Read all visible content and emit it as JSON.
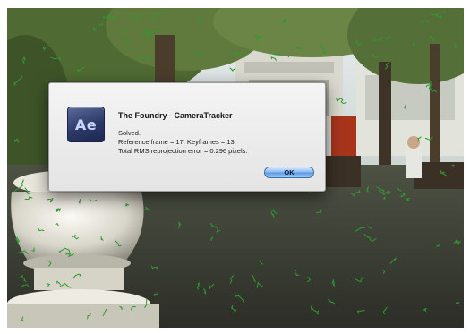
{
  "dialog": {
    "icon_text": "Ae",
    "title": "The Foundry - CameraTracker",
    "lines": [
      "Solved.",
      "Reference frame = 17. Keyframes = 13.",
      "Total RMS reprojection error = 0.296 pixels."
    ],
    "ok_label": "OK"
  },
  "colors": {
    "track_marks": "#2f9a2f",
    "ok_button": "#7fb4ee"
  },
  "icons": [
    "after-effects-app-icon"
  ]
}
